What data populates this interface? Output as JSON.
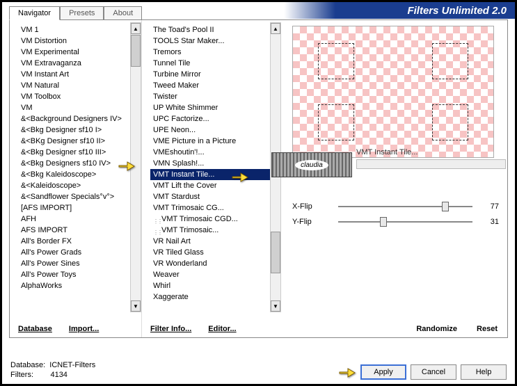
{
  "title": "Filters Unlimited 2.0",
  "tabs": [
    "Navigator",
    "Presets",
    "About"
  ],
  "active_tab": 0,
  "categories": [
    "VM 1",
    "VM Distortion",
    "VM Experimental",
    "VM Extravaganza",
    "VM Instant Art",
    "VM Natural",
    "VM Toolbox",
    "VM",
    "&<Background Designers IV>",
    "&<Bkg Designer sf10 I>",
    "&<BKg Designer sf10 II>",
    "&<Bkg Designer sf10 III>",
    "&<Bkg Designers sf10 IV>",
    "&<Bkg Kaleidoscope>",
    "&<Kaleidoscope>",
    "&<Sandflower Specials°v°>",
    "[AFS IMPORT]",
    "AFH",
    "AFS IMPORT",
    "All's Border FX",
    "All's Power Grads",
    "All's Power Sines",
    "All's Power Toys",
    "AlphaWorks"
  ],
  "category_selected_index": 11,
  "category_buttons": {
    "database": "Database",
    "import": "Import..."
  },
  "filters": [
    "The Toad's Pool II",
    "TOOLS Star Maker...",
    "Tremors",
    "Tunnel Tile",
    "Turbine Mirror",
    "Tweed Maker",
    "Twister",
    "UP White Shimmer",
    "UPC Factorize...",
    "UPE Neon...",
    "VME Picture in a Picture",
    "VMEshoutin'!...",
    "VMN Splash!...",
    "VMT Instant Tile...",
    "VMT Lift the Cover",
    "VMT Stardust",
    "VMT Trimosaic CG...",
    "VMT Trimosaic CGD...",
    "VMT Trimosaic...",
    "VR Nail Art",
    "VR Tiled Glass",
    "VR Wonderland",
    "Weaver",
    "Whirl",
    "Xaggerate"
  ],
  "filter_drag_indices": [
    17,
    18
  ],
  "filter_selected_index": 13,
  "filter_buttons": {
    "info": "Filter Info...",
    "editor": "Editor..."
  },
  "preview": {
    "filter_name": "VMT Instant Tile...",
    "watermark": "claudia"
  },
  "sliders": [
    {
      "label": "X-Flip",
      "value": 77
    },
    {
      "label": "Y-Flip",
      "value": 31
    }
  ],
  "right_buttons": {
    "randomize": "Randomize",
    "reset": "Reset"
  },
  "footer": {
    "db_label": "Database:",
    "db_value": "ICNET-Filters",
    "filters_label": "Filters:",
    "filters_value": "4134"
  },
  "buttons": {
    "apply": "Apply",
    "cancel": "Cancel",
    "help": "Help"
  }
}
